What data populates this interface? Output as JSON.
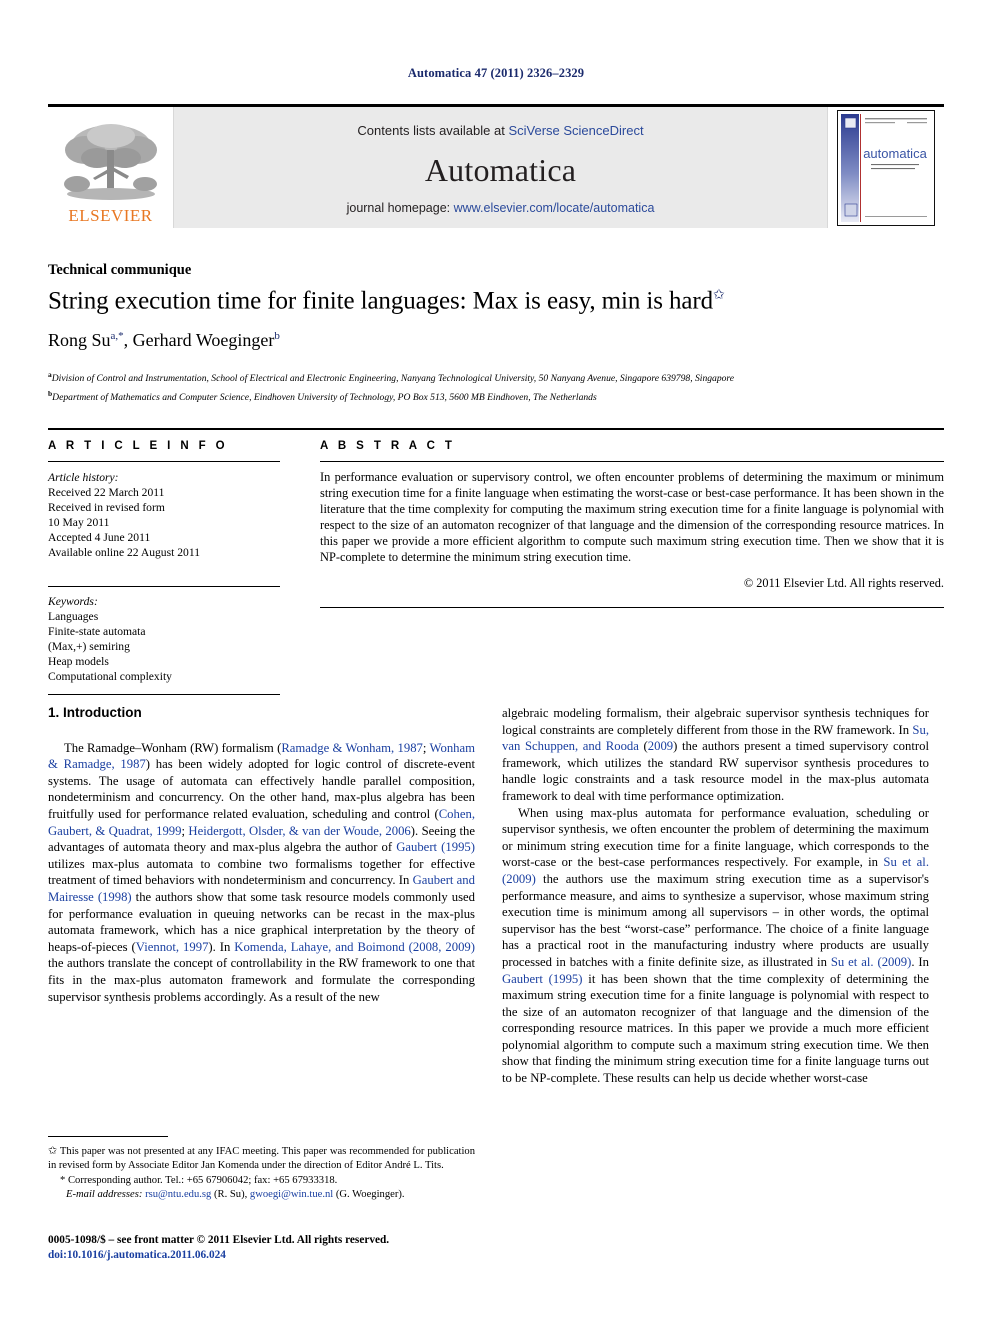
{
  "running_head": "Automatica 47 (2011) 2326–2329",
  "masthead": {
    "publisher_name": "ELSEVIER",
    "contents_prefix": "Contents lists available at ",
    "contents_link": "SciVerse ScienceDirect",
    "journal_name": "Automatica",
    "homepage_prefix": "journal homepage: ",
    "homepage_url": "www.elsevier.com/locate/automatica",
    "cover_title": "automatica",
    "cover_subtitle": "A JOURNAL OF IFAC, THE INTERNATIONAL FEDERATION OF AUTOMATIC CONTROL"
  },
  "article": {
    "section_label": "Technical communique",
    "title": "String execution time for finite languages: Max is easy, min is hard",
    "title_footnote_marker": "✩",
    "authors": [
      {
        "name": "Rong Su",
        "marks": "a,*"
      },
      {
        "name": "Gerhard Woeginger",
        "marks": "b"
      }
    ],
    "affiliations": [
      {
        "mark": "a",
        "text": "Division of Control and Instrumentation, School of Electrical and Electronic Engineering, Nanyang Technological University, 50 Nanyang Avenue, Singapore 639798, Singapore"
      },
      {
        "mark": "b",
        "text": "Department of Mathematics and Computer Science, Eindhoven University of Technology, PO Box 513, 5600 MB Eindhoven, The Netherlands"
      }
    ]
  },
  "info": {
    "heading": "A R T I C L E   I N F O",
    "history_title": "Article history:",
    "history": [
      "Received 22 March 2011",
      "Received in revised form",
      "10 May 2011",
      "Accepted 4 June 2011",
      "Available online 22 August 2011"
    ],
    "keywords_title": "Keywords:",
    "keywords": [
      "Languages",
      "Finite-state automata",
      "(Max,+) semiring",
      "Heap models",
      "Computational complexity"
    ]
  },
  "abstract": {
    "heading": "A B S T R A C T",
    "text": "In performance evaluation or supervisory control, we often encounter problems of determining the maximum or minimum string execution time for a finite language when estimating the worst-case or best-case performance. It has been shown in the literature that the time complexity for computing the maximum string execution time for a finite language is polynomial with respect to the size of an automaton recognizer of that language and the dimension of the corresponding resource matrices. In this paper we provide a more efficient algorithm to compute such maximum string execution time. Then we show that it is NP-complete to determine the minimum string execution time.",
    "copyright": "© 2011 Elsevier Ltd. All rights reserved."
  },
  "body": {
    "section_number_title": "1. Introduction",
    "left_paragraphs": [
      {
        "runs": [
          {
            "t": "The Ramadge–Wonham (RW) formalism (",
            "c": false
          },
          {
            "t": "Ramadge & Wonham, 1987",
            "c": true
          },
          {
            "t": "; ",
            "c": false
          },
          {
            "t": "Wonham & Ramadge, 1987",
            "c": true
          },
          {
            "t": ") has been widely adopted for logic control of discrete-event systems. The usage of automata can effectively handle parallel composition, nondeterminism and concurrency. On the other hand, max-plus algebra has been fruitfully used for performance related evaluation, scheduling and control (",
            "c": false
          },
          {
            "t": "Cohen, Gaubert, & Quadrat, 1999",
            "c": true
          },
          {
            "t": "; ",
            "c": false
          },
          {
            "t": "Heidergott, Olsder, & van der Woude, 2006",
            "c": true
          },
          {
            "t": "). Seeing the advantages of automata theory and max-plus algebra the author of ",
            "c": false
          },
          {
            "t": "Gaubert (1995)",
            "c": true
          },
          {
            "t": " utilizes max-plus automata to combine two formalisms together for effective treatment of timed behaviors with nondeterminism and concurrency. In ",
            "c": false
          },
          {
            "t": "Gaubert and Mairesse (1998)",
            "c": true
          },
          {
            "t": " the authors show that some task resource models commonly used for performance evaluation in queuing networks can be recast in the max-plus automata framework, which has a nice graphical interpretation by the theory of heaps-of-pieces (",
            "c": false
          },
          {
            "t": "Viennot, 1997",
            "c": true
          },
          {
            "t": "). In ",
            "c": false
          },
          {
            "t": "Komenda, Lahaye, and Boimond (2008, 2009)",
            "c": true
          },
          {
            "t": " the authors translate the concept of controllability in the RW framework to one that fits in the max-plus automaton framework and formulate the corresponding supervisor synthesis problems accordingly. As a result of the new",
            "c": false
          }
        ]
      }
    ],
    "right_paragraphs": [
      {
        "indent": false,
        "runs": [
          {
            "t": "algebraic modeling formalism, their algebraic supervisor synthesis techniques for logical constraints are completely different from those in the RW framework. In ",
            "c": false
          },
          {
            "t": "Su, van Schuppen, and Rooda",
            "c": true
          },
          {
            "t": " (",
            "c": false
          },
          {
            "t": "2009",
            "c": true
          },
          {
            "t": ") the authors present a timed supervisory control framework, which utilizes the standard RW supervisor synthesis procedures to handle logic constraints and a task resource model in the max-plus automata framework to deal with time performance optimization.",
            "c": false
          }
        ]
      },
      {
        "indent": true,
        "runs": [
          {
            "t": "When using max-plus automata for performance evaluation, scheduling or supervisor synthesis, we often encounter the problem of determining the maximum or minimum string execution time for a finite language, which corresponds to the worst-case or the best-case performances respectively. For example, in ",
            "c": false
          },
          {
            "t": "Su et al. (2009)",
            "c": true
          },
          {
            "t": " the authors use the maximum string execution time as a supervisor's performance measure, and aims to synthesize a supervisor, whose maximum string execution time is minimum among all supervisors – in other words, the optimal  supervisor has the best “worst-case” performance. The choice of a finite language has a practical root in the manufacturing industry where products are usually processed in batches with a finite definite size, as illustrated in ",
            "c": false
          },
          {
            "t": "Su et al. (2009)",
            "c": true
          },
          {
            "t": ". In ",
            "c": false
          },
          {
            "t": "Gaubert (1995)",
            "c": true
          },
          {
            "t": " it has been shown that the time complexity of determining the maximum string execution time for a finite language is polynomial with respect to the size of an automaton recognizer of that language and the dimension of the corresponding resource matrices. In this paper we provide a much more efficient polynomial algorithm to compute such a maximum string execution time. We then show that finding the minimum string execution time for a finite language turns out to be NP-complete. These results can help us decide whether worst-case",
            "c": false
          }
        ]
      }
    ]
  },
  "footnotes": {
    "star_marker": "✩",
    "star_text": "This paper was not presented at any IFAC meeting. This paper was recommended for publication in revised form by Associate Editor Jan Komenda under the direction of Editor André L. Tits.",
    "corresponding_marker": "*",
    "corresponding_text": "Corresponding author. Tel.: +65 67906042; fax: +65 67933318.",
    "email_label": "E-mail addresses:",
    "emails": [
      {
        "address": "rsu@ntu.edu.sg",
        "owner": "(R. Su)"
      },
      {
        "address": "gwoegi@win.tue.nl",
        "owner": "(G. Woeginger)"
      }
    ]
  },
  "imprint": {
    "line1": "0005-1098/$ – see front matter © 2011 Elsevier Ltd. All rights reserved.",
    "doi_label": "doi:",
    "doi_value": "10.1016/j.automatica.2011.06.024"
  },
  "colors": {
    "link_blue": "#2b4a9b",
    "cite_blue": "#1a3fa0",
    "elsevier_orange": "#E87722",
    "masthead_grey": "#eaeaea"
  }
}
